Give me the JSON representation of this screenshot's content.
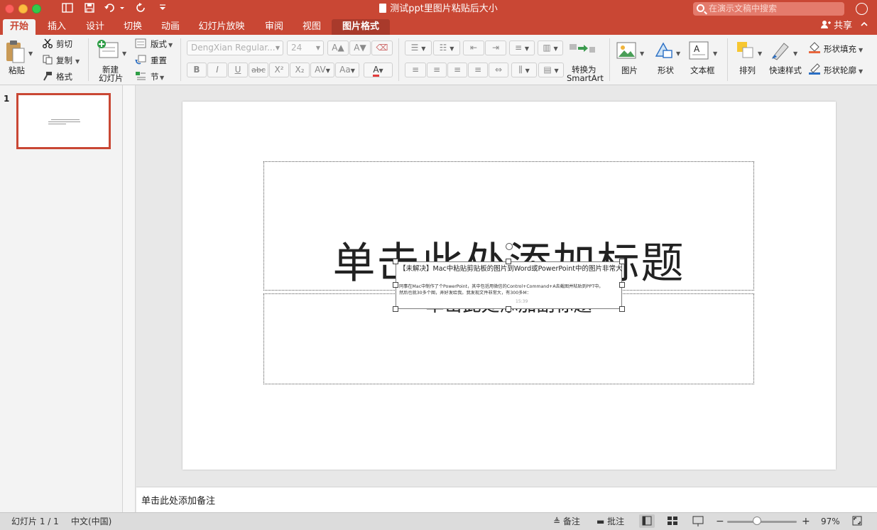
{
  "window": {
    "title": "测试ppt里图片粘贴后大小"
  },
  "search": {
    "placeholder": "在演示文稿中搜索"
  },
  "tabs": [
    {
      "label": "开始"
    },
    {
      "label": "插入"
    },
    {
      "label": "设计"
    },
    {
      "label": "切换"
    },
    {
      "label": "动画"
    },
    {
      "label": "幻灯片放映"
    },
    {
      "label": "审阅"
    },
    {
      "label": "视图"
    },
    {
      "label": "图片格式"
    }
  ],
  "share": {
    "label": "共享"
  },
  "ribbon": {
    "paste": "粘贴",
    "cut": "剪切",
    "copy": "复制",
    "format": "格式",
    "new_slide_1": "新建",
    "new_slide_2": "幻灯片",
    "layout": "版式",
    "reset": "重置",
    "section": "节",
    "font_name": "DengXian Regular...",
    "font_size": "24",
    "bold": "B",
    "italic": "I",
    "underline": "U",
    "strike": "abc",
    "superscript": "X²",
    "subscript": "X₂",
    "spacing": "AV",
    "case": "Aa",
    "font_color": "A",
    "convert_1": "转换为",
    "convert_2": "SmartArt",
    "picture": "图片",
    "shape": "形状",
    "textbox": "文本框",
    "arrange": "排列",
    "quick_styles": "快速样式",
    "shape_fill": "形状填充",
    "shape_outline": "形状轮廓"
  },
  "thumbnail": {
    "number": "1"
  },
  "slide": {
    "title_placeholder": "单击此处添加标题",
    "subtitle_placeholder": "单击此处添加副标题",
    "picture": {
      "title": "【未解决】Mac中粘贴剪贴板的图片到Word或PowerPoint中的图片非常大",
      "body_line1": "同事在Mac中制作了个PowerPoint，其中包括用微信的Control+Command+A去截图并粘贴到PPT中。",
      "body_line2": "然后也就30多个图，弄好发给我。我发现文件非常大，有300多M：",
      "time": "15:39"
    }
  },
  "notes": {
    "placeholder": "单击此处添加备注"
  },
  "status": {
    "slide_count": "幻灯片 1 / 1",
    "language": "中文(中国)",
    "notes_btn": "备注",
    "comments_btn": "批注",
    "zoom_out": "−",
    "zoom_in": "+",
    "zoom_percent": "97%",
    "zoom_level": 0.43
  },
  "colors": {
    "accent": "#c94734",
    "selected_tab_text": "#c94734"
  }
}
